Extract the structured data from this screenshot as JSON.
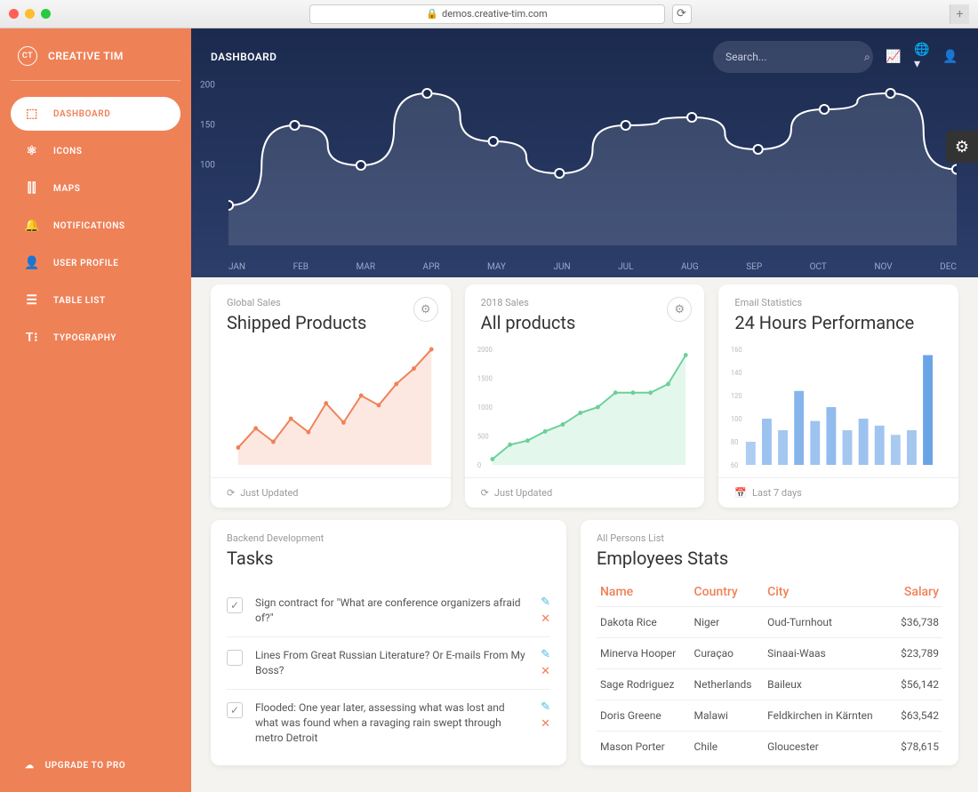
{
  "browser": {
    "url": "demos.creative-tim.com"
  },
  "brand": {
    "badge": "CT",
    "name": "CREATIVE TIM"
  },
  "sidebar": {
    "items": [
      {
        "label": "DASHBOARD",
        "icon": "⬚"
      },
      {
        "label": "ICONS",
        "icon": "⚛"
      },
      {
        "label": "MAPS",
        "icon": "⫿⫿"
      },
      {
        "label": "NOTIFICATIONS",
        "icon": "🔔"
      },
      {
        "label": "USER PROFILE",
        "icon": "👤"
      },
      {
        "label": "TABLE LIST",
        "icon": "☰"
      },
      {
        "label": "TYPOGRAPHY",
        "icon": "T⁝"
      }
    ],
    "upgrade": "UPGRADE TO PRO"
  },
  "header": {
    "title": "DASHBOARD",
    "search_placeholder": "Search..."
  },
  "chart_data": [
    {
      "type": "line",
      "name": "big_chart",
      "categories": [
        "JAN",
        "FEB",
        "MAR",
        "APR",
        "MAY",
        "JUN",
        "JUL",
        "AUG",
        "SEP",
        "OCT",
        "NOV",
        "DEC"
      ],
      "values": [
        50,
        150,
        100,
        190,
        130,
        90,
        150,
        160,
        120,
        170,
        190,
        95
      ],
      "ylim": [
        0,
        200
      ],
      "yticks": [
        100,
        150,
        200
      ]
    },
    {
      "type": "area",
      "name": "shipped_products",
      "subtitle": "Global Sales",
      "title": "Shipped Products",
      "x": [
        0,
        1,
        2,
        3,
        4,
        5,
        6,
        7,
        8,
        9,
        10,
        11
      ],
      "values": [
        290,
        390,
        320,
        440,
        370,
        520,
        420,
        560,
        510,
        620,
        700,
        800
      ],
      "ylim": [
        200,
        800
      ],
      "footer": "Just Updated",
      "color": "#ef8157"
    },
    {
      "type": "area",
      "name": "all_products",
      "subtitle": "2018 Sales",
      "title": "All products",
      "x": [
        0,
        1,
        2,
        3,
        4,
        5,
        6,
        7,
        8,
        9,
        10,
        11
      ],
      "values": [
        100,
        350,
        420,
        580,
        700,
        900,
        1000,
        1250,
        1250,
        1250,
        1400,
        1900
      ],
      "ylim": [
        0,
        2000
      ],
      "yticks": [
        0,
        500,
        1000,
        1500,
        2000
      ],
      "footer": "Just Updated",
      "color": "#6bd098"
    },
    {
      "type": "bar",
      "name": "email_stats",
      "subtitle": "Email Statistics",
      "title": "24 Hours Performance",
      "x": [
        0,
        1,
        2,
        3,
        4,
        5,
        6,
        7,
        8,
        9,
        10,
        11
      ],
      "values": [
        80,
        100,
        90,
        124,
        98,
        110,
        90,
        100,
        94,
        86,
        90,
        155
      ],
      "ylim": [
        60,
        160
      ],
      "yticks": [
        60,
        80,
        100,
        120,
        140,
        160
      ],
      "footer": "Last 7 days",
      "color": "#4a90e2"
    }
  ],
  "tasks": {
    "subtitle": "Backend Development",
    "title": "Tasks",
    "items": [
      {
        "text": "Sign contract for \"What are conference organizers afraid of?\"",
        "checked": true
      },
      {
        "text": "Lines From Great Russian Literature? Or E-mails From My Boss?",
        "checked": false
      },
      {
        "text": "Flooded: One year later, assessing what was lost and what was found when a ravaging rain swept through metro Detroit",
        "checked": true
      }
    ]
  },
  "employees": {
    "subtitle": "All Persons List",
    "title": "Employees Stats",
    "columns": [
      "Name",
      "Country",
      "City",
      "Salary"
    ],
    "rows": [
      [
        "Dakota Rice",
        "Niger",
        "Oud-Turnhout",
        "$36,738"
      ],
      [
        "Minerva Hooper",
        "Curaçao",
        "Sinaai-Waas",
        "$23,789"
      ],
      [
        "Sage Rodriguez",
        "Netherlands",
        "Baileux",
        "$56,142"
      ],
      [
        "Doris Greene",
        "Malawi",
        "Feldkirchen in Kärnten",
        "$63,542"
      ],
      [
        "Mason Porter",
        "Chile",
        "Gloucester",
        "$78,615"
      ]
    ]
  }
}
